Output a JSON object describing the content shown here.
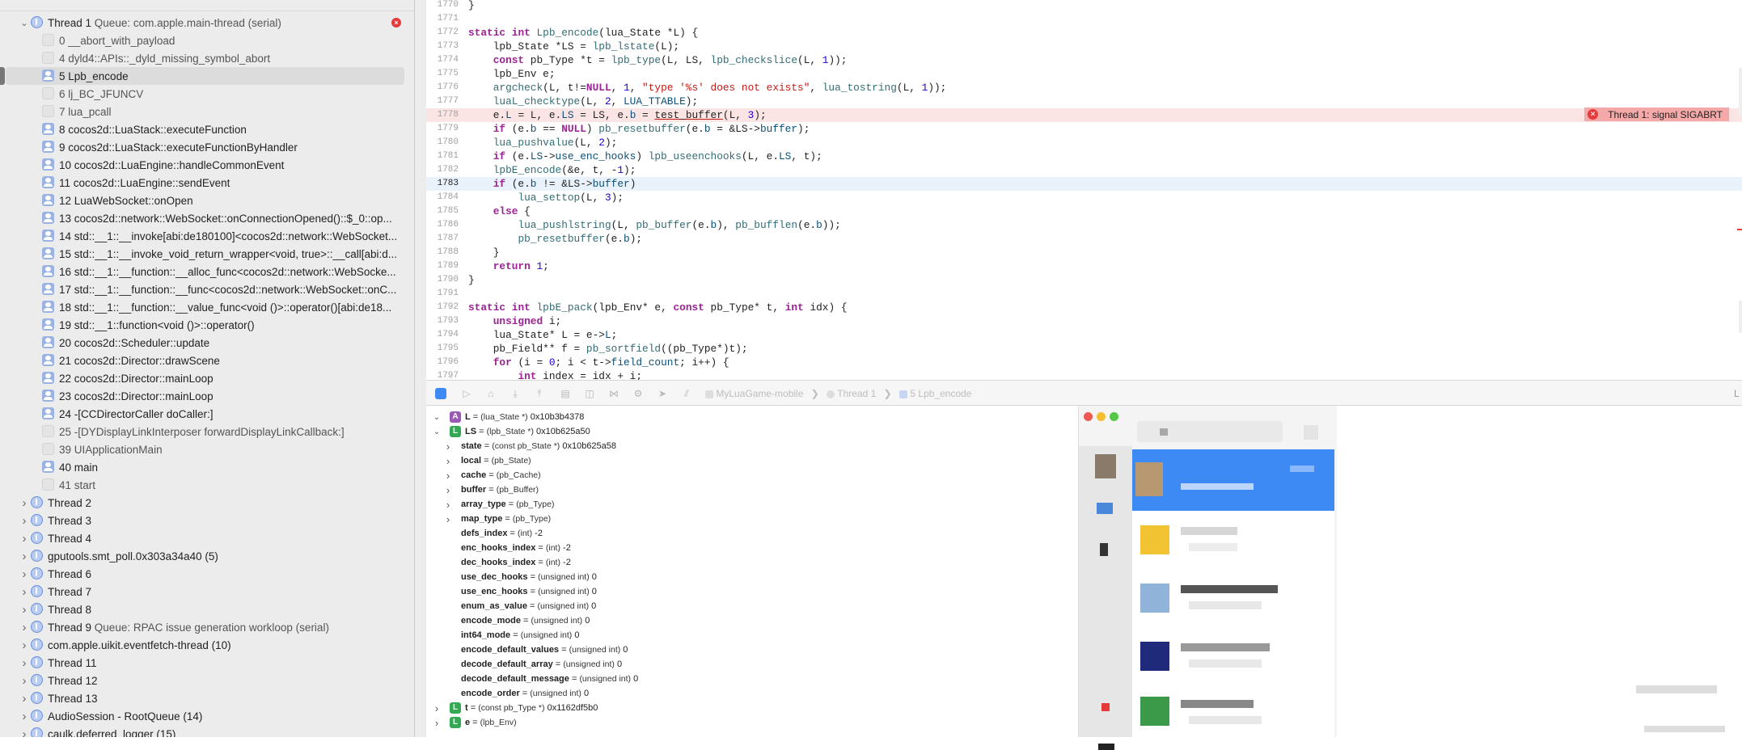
{
  "navigator": {
    "threads_expanded": {
      "label": "Thread 1",
      "queue": "Queue: com.apple.main-thread (serial)"
    },
    "frames": [
      {
        "label": "0 __abort_with_payload",
        "kind": "sys"
      },
      {
        "label": "4 dyld4::APIs::_dyld_missing_symbol_abort",
        "kind": "sys"
      },
      {
        "label": "5 Lpb_encode",
        "kind": "user",
        "selected": true
      },
      {
        "label": "6 lj_BC_JFUNCV",
        "kind": "sys"
      },
      {
        "label": "7 lua_pcall",
        "kind": "sys"
      },
      {
        "label": "8 cocos2d::LuaStack::executeFunction",
        "kind": "user"
      },
      {
        "label": "9 cocos2d::LuaStack::executeFunctionByHandler",
        "kind": "user"
      },
      {
        "label": "10 cocos2d::LuaEngine::handleCommonEvent",
        "kind": "user"
      },
      {
        "label": "11 cocos2d::LuaEngine::sendEvent",
        "kind": "user"
      },
      {
        "label": "12 LuaWebSocket::onOpen",
        "kind": "user"
      },
      {
        "label": "13 cocos2d::network::WebSocket::onConnectionOpened()::$_0::op...",
        "kind": "user"
      },
      {
        "label": "14 std::__1::__invoke[abi:de180100]<cocos2d::network::WebSocket...",
        "kind": "user"
      },
      {
        "label": "15 std::__1::__invoke_void_return_wrapper<void, true>::__call[abi:d...",
        "kind": "user"
      },
      {
        "label": "16 std::__1::__function::__alloc_func<cocos2d::network::WebSocke...",
        "kind": "user"
      },
      {
        "label": "17 std::__1::__function::__func<cocos2d::network::WebSocket::onC...",
        "kind": "user"
      },
      {
        "label": "18 std::__1::__function::__value_func<void ()>::operator()[abi:de18...",
        "kind": "user"
      },
      {
        "label": "19 std::__1::function<void ()>::operator()",
        "kind": "user"
      },
      {
        "label": "20 cocos2d::Scheduler::update",
        "kind": "user"
      },
      {
        "label": "21 cocos2d::Director::drawScene",
        "kind": "user"
      },
      {
        "label": "22 cocos2d::Director::mainLoop",
        "kind": "user"
      },
      {
        "label": "23 cocos2d::Director::mainLoop",
        "kind": "user"
      },
      {
        "label": "24 -[CCDirectorCaller doCaller:]",
        "kind": "user"
      },
      {
        "label": "25 -[DYDisplayLinkInterposer forwardDisplayLinkCallback:]",
        "kind": "sys"
      },
      {
        "label": "39 UIApplicationMain",
        "kind": "sys"
      },
      {
        "label": "40 main",
        "kind": "user"
      },
      {
        "label": "41 start",
        "kind": "sys"
      }
    ],
    "threads_collapsed": [
      {
        "label": "Thread 2",
        "queue": ""
      },
      {
        "label": "Thread 3",
        "queue": ""
      },
      {
        "label": "Thread 4",
        "queue": ""
      },
      {
        "label": "gputools.smt_poll.0x303a34a40 (5)",
        "queue": ""
      },
      {
        "label": "Thread 6",
        "queue": ""
      },
      {
        "label": "Thread 7",
        "queue": ""
      },
      {
        "label": "Thread 8",
        "queue": ""
      },
      {
        "label": "Thread 9",
        "queue": "Queue: RPAC issue generation workloop (serial)"
      },
      {
        "label": "com.apple.uikit.eventfetch-thread (10)",
        "queue": ""
      },
      {
        "label": "Thread 11",
        "queue": ""
      },
      {
        "label": "Thread 12",
        "queue": ""
      },
      {
        "label": "Thread 13",
        "queue": ""
      },
      {
        "label": "AudioSession - RootQueue (14)",
        "queue": ""
      },
      {
        "label": "caulk.deferred_logger (15)",
        "queue": ""
      }
    ]
  },
  "editor": {
    "lines": [
      {
        "n": "1770",
        "html": "}"
      },
      {
        "n": "1771",
        "html": ""
      },
      {
        "n": "1772",
        "html": "<span class=\"kw\">static</span> <span class=\"kw\">int</span> <span class=\"fn\">Lpb_encode</span>(lua_State *L) {"
      },
      {
        "n": "1773",
        "html": "    lpb_State *LS = <span class=\"fn\">lpb_lstate</span>(L);"
      },
      {
        "n": "1774",
        "html": "    <span class=\"kw\">const</span> pb_Type *t = <span class=\"fn\">lpb_type</span>(L, LS, <span class=\"fn\">lpb_checkslice</span>(L, <span class=\"nm\">1</span>));"
      },
      {
        "n": "1775",
        "html": "    lpb_Env e;"
      },
      {
        "n": "1776",
        "html": "    <span class=\"fn\">argcheck</span>(L, t!=<span class=\"kw\">NULL</span>, <span class=\"nm\">1</span>, <span class=\"st\">\"type '%s' does not exists\"</span>, <span class=\"fn\">lua_tostring</span>(L, <span class=\"nm\">1</span>));"
      },
      {
        "n": "1777",
        "html": "    <span class=\"fn\">luaL_checktype</span>(L, <span class=\"nm\">2</span>, <span class=\"ty\">LUA_TTABLE</span>);"
      },
      {
        "n": "1778",
        "html": "    e.<span class=\"ty\">L</span> = L, e.<span class=\"ty\">LS</span> = LS, e.<span class=\"ty\">b</span> = <span class=\"ul\">test_buffer</span>(L, <span class=\"nm\">3</span>);",
        "err": true
      },
      {
        "n": "1779",
        "html": "    <span class=\"kw\">if</span> (e.<span class=\"ty\">b</span> == <span class=\"kw\">NULL</span>) <span class=\"fn\">pb_resetbuffer</span>(e.<span class=\"ty\">b</span> = &amp;LS-&gt;<span class=\"ty\">buffer</span>);"
      },
      {
        "n": "1780",
        "html": "    <span class=\"fn\">lua_pushvalue</span>(L, <span class=\"nm\">2</span>);"
      },
      {
        "n": "1781",
        "html": "    <span class=\"kw\">if</span> (e.<span class=\"ty\">LS</span>-&gt;<span class=\"ty\">use_enc_hooks</span>) <span class=\"fn\">lpb_useenchooks</span>(L, e.<span class=\"ty\">LS</span>, t);"
      },
      {
        "n": "1782",
        "html": "    <span class=\"fn\">lpbE_encode</span>(&amp;e, t, -<span class=\"nm\">1</span>);"
      },
      {
        "n": "1783",
        "html": "    <span class=\"kw\">if</span> (e.<span class=\"ty\">b</span> != &amp;LS-&gt;<span class=\"ty\">buffer</span>)",
        "cur": true
      },
      {
        "n": "1784",
        "html": "        <span class=\"fn\">lua_settop</span>(L, <span class=\"nm\">3</span>);"
      },
      {
        "n": "1785",
        "html": "    <span class=\"kw\">else</span> {"
      },
      {
        "n": "1786",
        "html": "        <span class=\"fn\">lua_pushlstring</span>(L, <span class=\"fn\">pb_buffer</span>(e.<span class=\"ty\">b</span>), <span class=\"fn\">pb_bufflen</span>(e.<span class=\"ty\">b</span>));"
      },
      {
        "n": "1787",
        "html": "        <span class=\"fn\">pb_resetbuffer</span>(e.<span class=\"ty\">b</span>);"
      },
      {
        "n": "1788",
        "html": "    }"
      },
      {
        "n": "1789",
        "html": "    <span class=\"kw\">return</span> <span class=\"nm\">1</span>;"
      },
      {
        "n": "1790",
        "html": "}"
      },
      {
        "n": "1791",
        "html": ""
      },
      {
        "n": "1792",
        "html": "<span class=\"kw\">static</span> <span class=\"kw\">int</span> <span class=\"fn\">lpbE_pack</span>(lpb_Env* e, <span class=\"kw\">const</span> pb_Type* t, <span class=\"kw\">int</span> idx) {"
      },
      {
        "n": "1793",
        "html": "    <span class=\"kw\">unsigned</span> i;"
      },
      {
        "n": "1794",
        "html": "    lua_State* L = e-&gt;<span class=\"ty\">L</span>;"
      },
      {
        "n": "1795",
        "html": "    pb_Field** f = <span class=\"fn\">pb_sortfield</span>((pb_Type*)t);"
      },
      {
        "n": "1796",
        "html": "    <span class=\"kw\">for</span> (i = <span class=\"nm\">0</span>; i &lt; t-&gt;<span class=\"ty\">field_count</span>; i++) {"
      },
      {
        "n": "1797",
        "html": "        <span class=\"kw\">int</span> index = idx + i;"
      }
    ],
    "error_banner": "Thread 1: signal SIGABRT"
  },
  "debug_bar": {
    "crumbs": [
      "MyLuaGame-mobile",
      "Thread 1",
      "5 Lpb_encode"
    ]
  },
  "variables": [
    {
      "indent": 0,
      "chev": "v",
      "badge": "A",
      "name": "L",
      "type": "(lua_State *)",
      "value": "0x10b3b4378"
    },
    {
      "indent": 0,
      "chev": "v",
      "badge": "L",
      "name": "LS",
      "type": "(lpb_State *)",
      "value": "0x10b625a50"
    },
    {
      "indent": 1,
      "chev": ">",
      "name": "state",
      "type": "(const pb_State *)",
      "value": "0x10b625a58"
    },
    {
      "indent": 1,
      "chev": ">",
      "name": "local",
      "type": "(pb_State)",
      "value": ""
    },
    {
      "indent": 1,
      "chev": ">",
      "name": "cache",
      "type": "(pb_Cache)",
      "value": ""
    },
    {
      "indent": 1,
      "chev": ">",
      "name": "buffer",
      "type": "(pb_Buffer)",
      "value": ""
    },
    {
      "indent": 1,
      "chev": ">",
      "name": "array_type",
      "type": "(pb_Type)",
      "value": ""
    },
    {
      "indent": 1,
      "chev": ">",
      "name": "map_type",
      "type": "(pb_Type)",
      "value": ""
    },
    {
      "indent": 1,
      "chev": "",
      "name": "defs_index",
      "type": "(int)",
      "value": "-2"
    },
    {
      "indent": 1,
      "chev": "",
      "name": "enc_hooks_index",
      "type": "(int)",
      "value": "-2"
    },
    {
      "indent": 1,
      "chev": "",
      "name": "dec_hooks_index",
      "type": "(int)",
      "value": "-2"
    },
    {
      "indent": 1,
      "chev": "",
      "name": "use_dec_hooks",
      "type": "(unsigned int)",
      "value": "0"
    },
    {
      "indent": 1,
      "chev": "",
      "name": "use_enc_hooks",
      "type": "(unsigned int)",
      "value": "0"
    },
    {
      "indent": 1,
      "chev": "",
      "name": "enum_as_value",
      "type": "(unsigned int)",
      "value": "0"
    },
    {
      "indent": 1,
      "chev": "",
      "name": "encode_mode",
      "type": "(unsigned int)",
      "value": "0"
    },
    {
      "indent": 1,
      "chev": "",
      "name": "int64_mode",
      "type": "(unsigned int)",
      "value": "0"
    },
    {
      "indent": 1,
      "chev": "",
      "name": "encode_default_values",
      "type": "(unsigned int)",
      "value": "0"
    },
    {
      "indent": 1,
      "chev": "",
      "name": "decode_default_array",
      "type": "(unsigned int)",
      "value": "0"
    },
    {
      "indent": 1,
      "chev": "",
      "name": "decode_default_message",
      "type": "(unsigned int)",
      "value": "0"
    },
    {
      "indent": 1,
      "chev": "",
      "name": "encode_order",
      "type": "(unsigned int)",
      "value": "0"
    },
    {
      "indent": 0,
      "chev": ">",
      "badge": "L",
      "name": "t",
      "type": "(const pb_Type *)",
      "value": "0x1162df5b0"
    },
    {
      "indent": 0,
      "chev": ">",
      "badge": "L",
      "name": "e",
      "type": "(lpb_Env)",
      "value": ""
    }
  ],
  "colors": {
    "accent": "#3d8af5",
    "error": "#e5393c",
    "error_line": "#fbe4e4",
    "current_line": "#e9f1fb"
  }
}
